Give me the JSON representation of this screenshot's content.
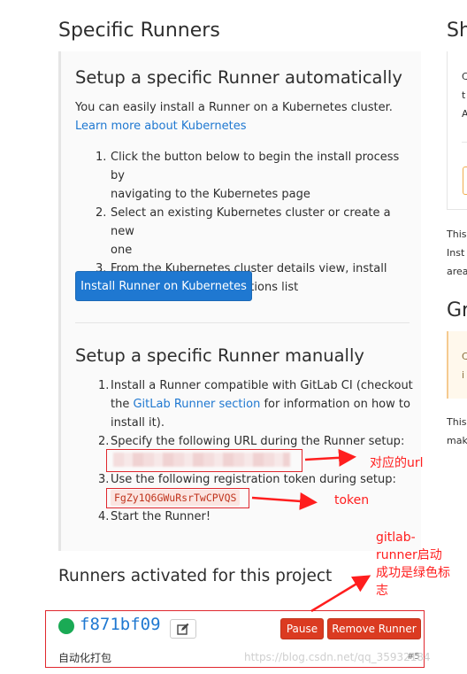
{
  "main": {
    "title": "Specific Runners",
    "auto": {
      "heading": "Setup a specific Runner automatically",
      "intro": "You can easily install a Runner on a Kubernetes cluster.",
      "learn_link": "Learn more about Kubernetes",
      "steps": [
        {
          "num": "1.",
          "line1": "Click the button below to begin the install process by",
          "line2": "navigating to the Kubernetes page"
        },
        {
          "num": "2.",
          "line1": "Select an existing Kubernetes cluster or create a new",
          "line2": "one"
        },
        {
          "num": "3.",
          "line1": "From the Kubernetes cluster details view, install",
          "line2": "Runner from the applications list"
        }
      ],
      "install_button": "Install Runner on Kubernetes"
    },
    "manual": {
      "heading": "Setup a specific Runner manually",
      "step1_line1": "Install a Runner compatible with GitLab CI (checkout",
      "step1_the": "the ",
      "step1_link": "GitLab Runner section",
      "step1_rest": " for information on how to",
      "step1_line3": "install it).",
      "step2": "Specify the following URL during the Runner setup:",
      "step3": "Use the following registration token during setup:",
      "token": "FgZy1Q6GWuRsrTwCPVQS",
      "step4": "Start the Runner!",
      "nums": [
        "1.",
        "2.",
        "3.",
        "4."
      ]
    },
    "activated": {
      "title": "Runners activated for this project",
      "runner_id": "f871bf09",
      "runner_description": "自动化打包",
      "runner_number": "#5",
      "pause_button": "Pause",
      "remove_button": "Remove Runner",
      "status_color": "#1aaa55",
      "edit_icon": "pencil-square-icon"
    }
  },
  "right_column": {
    "title_fragment": "Sh",
    "panel_letters": [
      "C",
      "t",
      "A"
    ],
    "text1": [
      "This",
      "Inst",
      "area"
    ],
    "title2_fragment": "Gr",
    "warn_letters": [
      "C",
      "i"
    ],
    "text2": [
      "This",
      "mak"
    ]
  },
  "annotations": {
    "url_label": "对应的url",
    "token_label": "token",
    "runner_label_line1": "gitlab-",
    "runner_label_line2": "runner启动",
    "runner_label_line3": "成功是绿色标",
    "runner_label_line4": "志"
  },
  "watermark": "https://blog.csdn.net/qq_35932184",
  "colors": {
    "accent_blue": "#1f78d1",
    "danger_red": "#db3b21",
    "annotation_red": "#ff1e1e",
    "success_green": "#1aaa55",
    "warning_border": "#f5ca90"
  }
}
